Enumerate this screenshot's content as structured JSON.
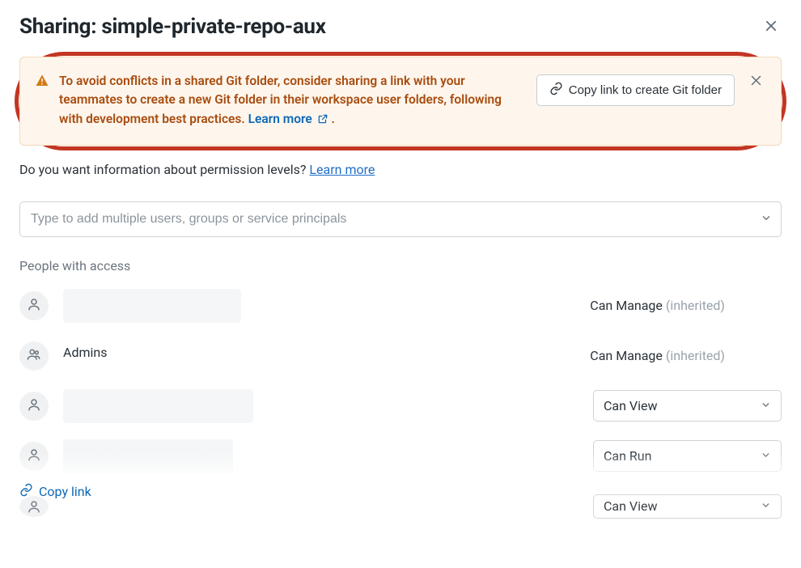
{
  "header": {
    "title": "Sharing: simple-private-repo-aux"
  },
  "alert": {
    "message": "To avoid conflicts in a shared Git folder, consider sharing a link with your teammates to create a new Git folder in their workspace user folders, following with development best practices.",
    "learn_more_label": "Learn more",
    "button_label": "Copy link to create Git folder"
  },
  "info": {
    "question": "Do you want information about permission levels? ",
    "learn_more_label": "Learn more"
  },
  "search": {
    "placeholder": "Type to add multiple users, groups or service principals"
  },
  "people": {
    "section_label": "People with access",
    "rows": [
      {
        "type": "user",
        "name": "",
        "permission_label": "Can Manage",
        "inherited_label": "(inherited)",
        "editable": false
      },
      {
        "type": "group",
        "name": "Admins",
        "permission_label": "Can Manage",
        "inherited_label": "(inherited)",
        "editable": false
      },
      {
        "type": "user",
        "name": "",
        "permission_label": "Can View",
        "inherited_label": "",
        "editable": true
      },
      {
        "type": "user",
        "name": "",
        "permission_label": "Can Run",
        "inherited_label": "",
        "editable": true
      },
      {
        "type": "user",
        "name": "",
        "permission_label": "Can View",
        "inherited_label": "",
        "editable": true
      }
    ]
  },
  "footer": {
    "copy_link_label": "Copy link"
  }
}
